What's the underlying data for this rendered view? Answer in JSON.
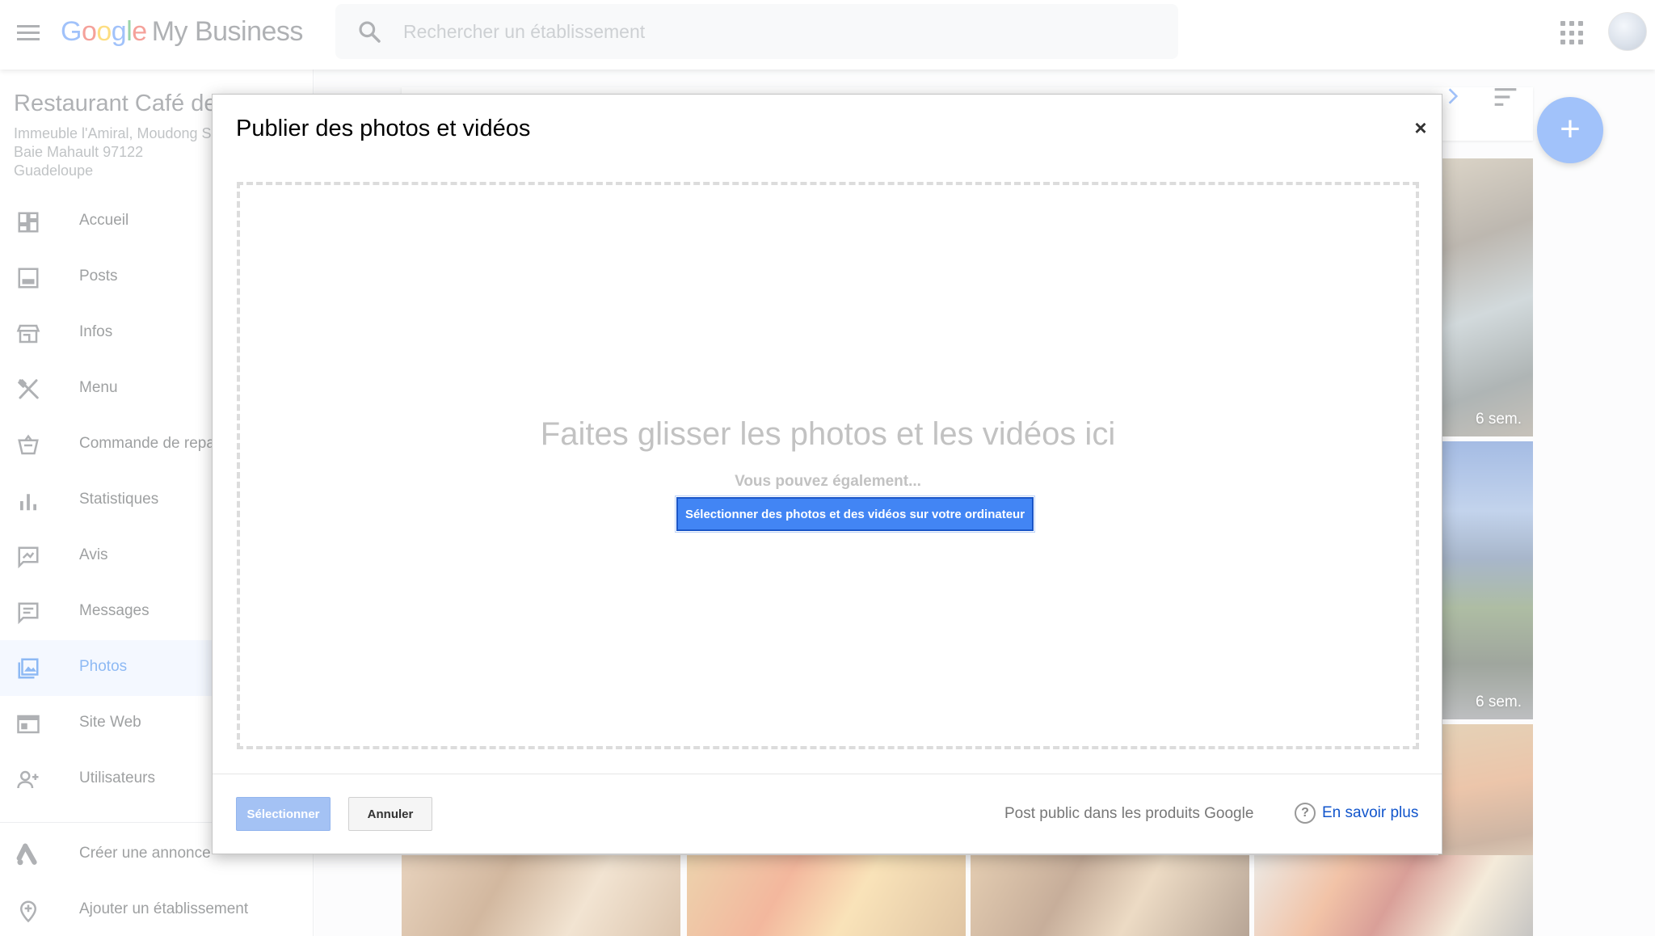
{
  "header": {
    "logo_letters": [
      "G",
      "o",
      "o",
      "g",
      "l",
      "e"
    ],
    "logo_colors": [
      "#4285f4",
      "#ea4335",
      "#fbbc05",
      "#4285f4",
      "#34a853",
      "#ea4335"
    ],
    "product_name": "My Business",
    "search_placeholder": "Rechercher un établissement",
    "menu_icon": "hamburger-menu-icon",
    "apps_icon": "apps-grid-icon"
  },
  "business": {
    "name": "Restaurant Café de",
    "address_line1": "Immeuble l'Amiral, Moudong S",
    "address_line2": "Baie Mahault 97122",
    "address_line3": "Guadeloupe"
  },
  "sidebar": {
    "items": [
      {
        "label": "Accueil",
        "icon": "dashboard-icon"
      },
      {
        "label": "Posts",
        "icon": "posts-icon"
      },
      {
        "label": "Infos",
        "icon": "storefront-icon"
      },
      {
        "label": "Menu",
        "icon": "utensils-icon"
      },
      {
        "label": "Commande de repa",
        "icon": "food-order-icon"
      },
      {
        "label": "Statistiques",
        "icon": "bar-chart-icon"
      },
      {
        "label": "Avis",
        "icon": "review-icon"
      },
      {
        "label": "Messages",
        "icon": "message-icon"
      },
      {
        "label": "Photos",
        "icon": "photo-library-icon",
        "active": true
      },
      {
        "label": "Site Web",
        "icon": "website-icon"
      },
      {
        "label": "Utilisateurs",
        "icon": "add-user-icon"
      }
    ],
    "bottom_items": [
      {
        "label": "Créer une annonce",
        "icon": "google-ads-icon"
      },
      {
        "label": "Ajouter un établissement",
        "icon": "add-location-icon"
      }
    ]
  },
  "gallery": {
    "age_label_1": "6 sem.",
    "age_label_2": "6 sem."
  },
  "dialog": {
    "title": "Publier des photos et vidéos",
    "close_symbol": "×",
    "drop_title": "Faites glisser les photos et les vidéos ici",
    "drop_sub": "Vous pouvez également...",
    "pick_button": "Sélectionner des photos et des vidéos sur votre ordinateur",
    "select_button": "Sélectionner",
    "cancel_button": "Annuler",
    "footer_note": "Post public dans les produits Google",
    "help_symbol": "?",
    "learn_more": "En savoir plus"
  },
  "colors": {
    "accent": "#4285f4",
    "active_nav_bg": "#e8f0fe",
    "active_nav_text": "#1a73e8",
    "link": "#1155cc"
  }
}
